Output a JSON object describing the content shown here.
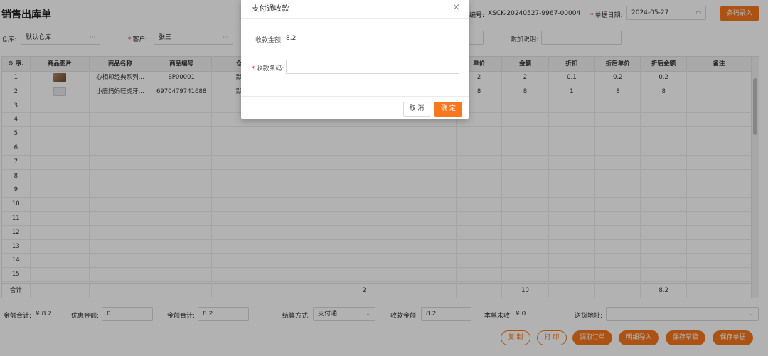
{
  "page": {
    "title": "销售出库单"
  },
  "header": {
    "order_no_label": "编号:",
    "order_no_value": "XSCK-20240527-9967-00004",
    "date_label": "单据日期:",
    "date_value": "2024-05-27",
    "barcode_entry_button": "条码录入",
    "warehouse_label": "仓库:",
    "warehouse_value": "默认仓库",
    "customer_label": "客户:",
    "customer_value": "张三",
    "extra_note_label": "附加说明:",
    "extra_note_value": ""
  },
  "table": {
    "columns": [
      "序.",
      "商品图片",
      "商品名称",
      "商品编号",
      "仓库",
      "",
      "",
      "",
      "单价",
      "金额",
      "折扣",
      "折后单价",
      "折后金额",
      "备注"
    ],
    "rows": [
      {
        "no": "1",
        "name": "心相印经典系列...",
        "code": "SP00001",
        "warehouse": "默认",
        "qty": "",
        "price": "2",
        "amount": "2",
        "discount": "0.1",
        "disc_price": "0.2",
        "disc_amount": "0.2",
        "note": ""
      },
      {
        "no": "2",
        "name": "小鹿妈妈旺虎牙...",
        "code": "6970479741688",
        "warehouse": "默认",
        "qty": "",
        "price": "8",
        "amount": "8",
        "discount": "1",
        "disc_price": "8",
        "disc_amount": "8",
        "note": ""
      },
      {
        "no": "3"
      },
      {
        "no": "4"
      },
      {
        "no": "5"
      },
      {
        "no": "6"
      },
      {
        "no": "7"
      },
      {
        "no": "8"
      },
      {
        "no": "9"
      },
      {
        "no": "10"
      },
      {
        "no": "11"
      },
      {
        "no": "12"
      },
      {
        "no": "13"
      },
      {
        "no": "14"
      },
      {
        "no": "15"
      }
    ],
    "footer": {
      "label": "合计",
      "qty_total": "2",
      "amount_total": "10",
      "disc_amount_total": "8.2"
    }
  },
  "summary": {
    "amount_total_label": "金额合计:",
    "amount_total_value": "¥ 8.2",
    "discount_label": "优惠金额:",
    "discount_value": "0",
    "sum_label": "金额合计:",
    "sum_value": "8.2",
    "settle_label": "结算方式:",
    "settle_value": "支付通",
    "received_label": "收款金额:",
    "received_value": "8.2",
    "unpaid_label": "本单未收:",
    "unpaid_value": "¥ 0",
    "delivery_label": "送货地址:",
    "delivery_value": ""
  },
  "actions": {
    "copy": "复 制",
    "print": "打 印",
    "pull_order": "调取订单",
    "import_detail": "明细导入",
    "save_draft": "保存草稿",
    "save_doc": "保存单据"
  },
  "modal": {
    "title": "支付通收款",
    "close": "×",
    "amount_label": "收款金额:",
    "amount_value": "8.2",
    "barcode_label": "收款条码:",
    "barcode_value": "",
    "cancel": "取 消",
    "ok": "确 定"
  },
  "colors": {
    "accent": "#f7781e",
    "required": "#e4393c"
  }
}
